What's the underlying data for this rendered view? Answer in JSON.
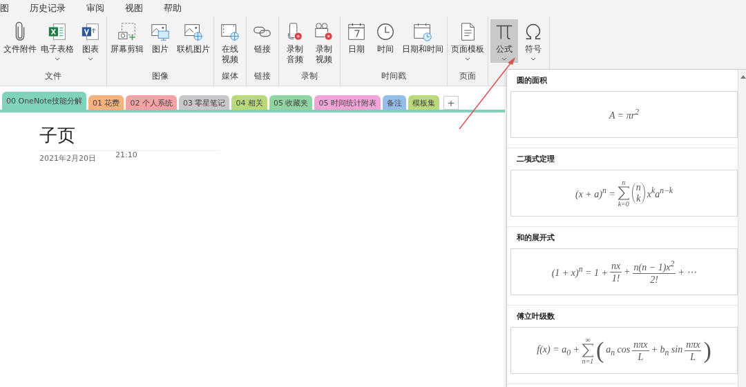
{
  "menu": [
    {
      "label": "图"
    },
    {
      "label": "历史记录"
    },
    {
      "label": "审阅"
    },
    {
      "label": "视图"
    },
    {
      "label": "帮助"
    }
  ],
  "ribbon_groups": [
    {
      "label": "文件",
      "items": [
        {
          "kind": "paperclip",
          "label": "文件附件",
          "dropdown": false,
          "selected": false
        },
        {
          "kind": "excel",
          "label": "电子表格",
          "dropdown": true,
          "selected": false
        },
        {
          "kind": "visio",
          "label": "图表",
          "dropdown": true,
          "selected": false
        }
      ]
    },
    {
      "label": "图像",
      "items": [
        {
          "kind": "screenclip",
          "label": "屏幕剪辑",
          "dropdown": false,
          "selected": false
        },
        {
          "kind": "picture",
          "label": "图片",
          "dropdown": false,
          "selected": false
        },
        {
          "kind": "online-picture",
          "label": "联机图片",
          "dropdown": false,
          "selected": false
        }
      ]
    },
    {
      "label": "媒体",
      "items": [
        {
          "kind": "online-video",
          "label": "在线视频",
          "dropdown": false,
          "selected": false
        }
      ]
    },
    {
      "label": "链接",
      "items": [
        {
          "kind": "link",
          "label": "链接",
          "dropdown": false,
          "selected": false
        }
      ]
    },
    {
      "label": "录制",
      "items": [
        {
          "kind": "audio",
          "label": "录制音频",
          "dropdown": false,
          "selected": false
        },
        {
          "kind": "video",
          "label": "录制视频",
          "dropdown": false,
          "selected": false
        }
      ]
    },
    {
      "label": "时间戳",
      "items": [
        {
          "kind": "calendar",
          "label": "日期",
          "dropdown": false,
          "selected": false
        },
        {
          "kind": "clock",
          "label": "时间",
          "dropdown": false,
          "selected": false
        },
        {
          "kind": "calendar-clock",
          "label": "日期和时间",
          "dropdown": false,
          "selected": false
        }
      ]
    },
    {
      "label": "页面",
      "items": [
        {
          "kind": "page",
          "label": "页面模板",
          "dropdown": true,
          "selected": false
        }
      ]
    },
    {
      "items": [
        {
          "kind": "pi",
          "label": "公式",
          "dropdown": true,
          "selected": true
        },
        {
          "kind": "omega",
          "label": "符号",
          "dropdown": true,
          "selected": false
        }
      ]
    }
  ],
  "section_tabs": [
    {
      "label": "00 OneNote技能分解",
      "color": "#7fd3bd",
      "selected": true
    },
    {
      "label": "01 花费",
      "color": "#f5b27e",
      "selected": false
    },
    {
      "label": "02 个人系统",
      "color": "#f3a3a6",
      "selected": false
    },
    {
      "label": "03 零星笔记",
      "color": "#c8c8cc",
      "selected": false
    },
    {
      "label": "04 相关",
      "color": "#b9d97c",
      "selected": false
    },
    {
      "label": "05 收藏夹",
      "color": "#8fd4a2",
      "selected": false
    },
    {
      "label": "05 时间统计附表",
      "color": "#f0a5d8",
      "selected": false
    },
    {
      "label": "备注",
      "color": "#94bde9",
      "selected": false
    },
    {
      "label": "模板集",
      "color": "#b9d97c",
      "selected": false
    }
  ],
  "add_tab": "+",
  "page": {
    "title": "子页",
    "date": "2021年2月20日",
    "time": "21:10"
  },
  "equation_gallery": [
    {
      "title": "圆的面积",
      "formula": [
        {
          "kind": "text",
          "text": "A = πr$^{2}$"
        }
      ]
    },
    {
      "title": "二项式定理",
      "formula": [
        {
          "kind": "text",
          "text": "(x + a)$^{n}$ ="
        },
        {
          "kind": "sum",
          "upper": "n",
          "lower": "k=0"
        },
        {
          "kind": "binom",
          "top": "n",
          "bottom": "k"
        },
        {
          "kind": "text",
          "text": "x$^{k}$a$^{n−k}$"
        }
      ]
    },
    {
      "title": "和的展开式",
      "formula": [
        {
          "kind": "text",
          "text": "(1 + x)$^{n}$ = 1 +"
        },
        {
          "kind": "frac",
          "num": "nx",
          "den": "1!"
        },
        {
          "kind": "text",
          "text": "+"
        },
        {
          "kind": "frac",
          "num": "n(n − 1)x$^{2}$",
          "den": "2!"
        },
        {
          "kind": "text",
          "text": "+ ⋯"
        }
      ]
    },
    {
      "title": "傅立叶级数",
      "formula": [
        {
          "kind": "text",
          "text": "f(x) = a$_{0}$ +"
        },
        {
          "kind": "sum",
          "upper": "∞",
          "lower": "n=1"
        },
        {
          "kind": "delim",
          "text": "("
        },
        {
          "kind": "text",
          "text": "a$_{n}$ cos"
        },
        {
          "kind": "frac",
          "num": "nπx",
          "den": "L"
        },
        {
          "kind": "text",
          "text": "+ b$_{n}$ sin"
        },
        {
          "kind": "frac",
          "num": "nπx",
          "den": "L"
        },
        {
          "kind": "delim",
          "text": ")"
        }
      ]
    }
  ]
}
